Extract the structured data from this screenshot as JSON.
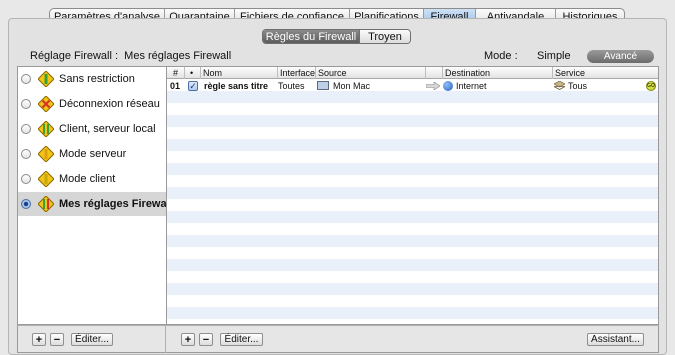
{
  "top_tabs": [
    {
      "label": "Paramètres d'analyse",
      "active": false
    },
    {
      "label": "Quarantaine",
      "active": false
    },
    {
      "label": "Fichiers de confiance",
      "active": false
    },
    {
      "label": "Planifications",
      "active": false
    },
    {
      "label": "Firewall",
      "active": true
    },
    {
      "label": "Antivandale",
      "active": false
    },
    {
      "label": "Historiques",
      "active": false
    }
  ],
  "sub_tabs": [
    {
      "label": "Règles du Firewall",
      "active": true
    },
    {
      "label": "Troyen",
      "active": false
    }
  ],
  "info_bar": {
    "setting_label": "Réglage Firewall :",
    "setting_value": "Mes réglages Firewall",
    "mode_label": "Mode :",
    "mode_simple": "Simple",
    "mode_advanced": "Avancé",
    "mode_selected": "Avancé"
  },
  "profiles": [
    {
      "label": "Sans restriction",
      "selected": false,
      "icon": "shield-allow-icon"
    },
    {
      "label": "Déconnexion réseau",
      "selected": false,
      "icon": "shield-block-icon"
    },
    {
      "label": "Client, serveur local",
      "selected": false,
      "icon": "shield-local-icon"
    },
    {
      "label": "Mode serveur",
      "selected": false,
      "icon": "shield-server-icon"
    },
    {
      "label": "Mode client",
      "selected": false,
      "icon": "shield-client-icon"
    },
    {
      "label": "Mes réglages Firewall",
      "selected": true,
      "icon": "shield-custom-icon"
    }
  ],
  "table": {
    "columns": {
      "num": "#",
      "active": "•",
      "name": "Nom",
      "interface": "Interface",
      "source": "Source",
      "destination": "Destination",
      "service": "Service"
    },
    "rows": [
      {
        "num": "01",
        "checked": true,
        "check_mark": "✓",
        "name": "règle sans titre",
        "interface": "Toutes",
        "source": "Mon Mac",
        "source_icon": "computer-icon",
        "arrow_icon": "arrow-right-icon",
        "destination": "Internet",
        "destination_icon": "globe-icon",
        "service": "Tous",
        "service_icon": "service-stack-icon",
        "action": "GO",
        "action_icon": "go-icon"
      }
    ]
  },
  "bottom_bar": {
    "add_profile": "+",
    "remove_profile": "−",
    "edit_profile": "Éditer...",
    "add_rule": "+",
    "remove_rule": "−",
    "edit_rule": "Éditer...",
    "assistant": "Assistant..."
  },
  "colors": {
    "accent_tab": "#9ec2e8",
    "stripe": "#e9f0fa",
    "selected_profile": "#d6d6d6",
    "shield_yellow": "#f2c418",
    "shield_green": "#3aa035",
    "shield_red": "#d8322a"
  }
}
